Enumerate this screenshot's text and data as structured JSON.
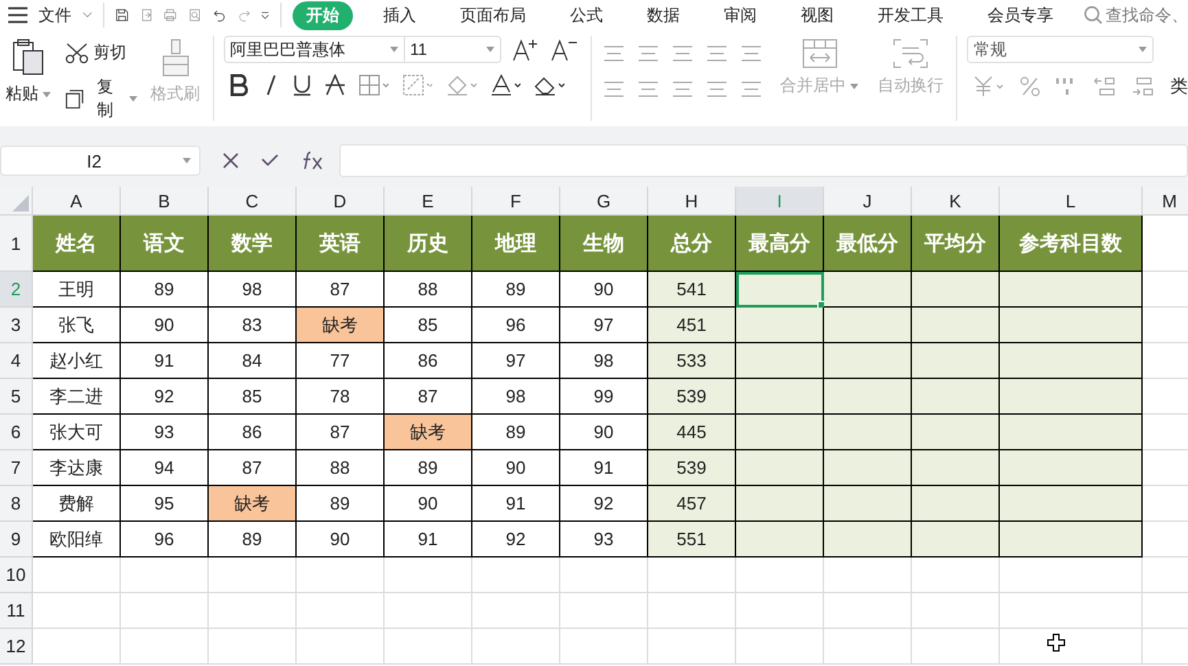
{
  "menu_bar": {
    "file_label": "文件",
    "tabs": [
      {
        "label": "开始",
        "selected": true
      },
      {
        "label": "插入",
        "selected": false
      },
      {
        "label": "页面布局",
        "selected": false
      },
      {
        "label": "公式",
        "selected": false
      },
      {
        "label": "数据",
        "selected": false
      },
      {
        "label": "审阅",
        "selected": false
      },
      {
        "label": "视图",
        "selected": false
      },
      {
        "label": "开发工具",
        "selected": false
      },
      {
        "label": "会员专享",
        "selected": false
      }
    ],
    "search": "查找命令、"
  },
  "ribbon": {
    "paste": "粘贴",
    "cut": "剪切",
    "copy": "复制",
    "format_painter": "格式刷",
    "font_family": "阿里巴巴普惠体",
    "font_size": "11",
    "merge_center": "合并居中",
    "wrap_text": "自动换行",
    "number_format": "常规",
    "type_label": "类"
  },
  "formula_bar": {
    "cell_ref": "I2"
  },
  "sheet": {
    "columns": [
      {
        "label": "A",
        "selected": false
      },
      {
        "label": "B",
        "selected": false
      },
      {
        "label": "C",
        "selected": false
      },
      {
        "label": "D",
        "selected": false
      },
      {
        "label": "E",
        "selected": false
      },
      {
        "label": "F",
        "selected": false
      },
      {
        "label": "G",
        "selected": false
      },
      {
        "label": "H",
        "selected": false
      },
      {
        "label": "I",
        "selected": true
      },
      {
        "label": "J",
        "selected": false
      },
      {
        "label": "K",
        "selected": false
      },
      {
        "label": "L",
        "selected": false
      },
      {
        "label": "M",
        "selected": false
      }
    ],
    "rows": [
      {
        "label": "1",
        "selected": false,
        "cells": [
          {
            "text": "姓名",
            "kind": "header"
          },
          {
            "text": "语文",
            "kind": "header"
          },
          {
            "text": "数学",
            "kind": "header"
          },
          {
            "text": "英语",
            "kind": "header"
          },
          {
            "text": "历史",
            "kind": "header"
          },
          {
            "text": "地理",
            "kind": "header"
          },
          {
            "text": "生物",
            "kind": "header"
          },
          {
            "text": "总分",
            "kind": "header"
          },
          {
            "text": "最高分",
            "kind": "header"
          },
          {
            "text": "最低分",
            "kind": "header"
          },
          {
            "text": "平均分",
            "kind": "header"
          },
          {
            "text": "参考科目数",
            "kind": "header"
          }
        ]
      },
      {
        "label": "2",
        "selected": true,
        "cells": [
          {
            "text": "王明",
            "kind": "value"
          },
          {
            "text": "89",
            "kind": "value"
          },
          {
            "text": "98",
            "kind": "value"
          },
          {
            "text": "87",
            "kind": "value"
          },
          {
            "text": "88",
            "kind": "value"
          },
          {
            "text": "89",
            "kind": "value"
          },
          {
            "text": "90",
            "kind": "value"
          },
          {
            "text": "541",
            "kind": "total"
          },
          {
            "kind": "stat"
          },
          {
            "kind": "stat"
          },
          {
            "kind": "stat"
          },
          {
            "kind": "stat"
          }
        ]
      },
      {
        "label": "3",
        "selected": false,
        "cells": [
          {
            "text": "张飞",
            "kind": "value"
          },
          {
            "text": "90",
            "kind": "value"
          },
          {
            "text": "83",
            "kind": "value"
          },
          {
            "text": "缺考",
            "kind": "missing"
          },
          {
            "text": "85",
            "kind": "value"
          },
          {
            "text": "96",
            "kind": "value"
          },
          {
            "text": "97",
            "kind": "value"
          },
          {
            "text": "451",
            "kind": "total"
          },
          {
            "kind": "stat"
          },
          {
            "kind": "stat"
          },
          {
            "kind": "stat"
          },
          {
            "kind": "stat"
          }
        ]
      },
      {
        "label": "4",
        "selected": false,
        "cells": [
          {
            "text": "赵小红",
            "kind": "value"
          },
          {
            "text": "91",
            "kind": "value"
          },
          {
            "text": "84",
            "kind": "value"
          },
          {
            "text": "77",
            "kind": "value"
          },
          {
            "text": "86",
            "kind": "value"
          },
          {
            "text": "97",
            "kind": "value"
          },
          {
            "text": "98",
            "kind": "value"
          },
          {
            "text": "533",
            "kind": "total"
          },
          {
            "kind": "stat"
          },
          {
            "kind": "stat"
          },
          {
            "kind": "stat"
          },
          {
            "kind": "stat"
          }
        ]
      },
      {
        "label": "5",
        "selected": false,
        "cells": [
          {
            "text": "李二进",
            "kind": "value"
          },
          {
            "text": "92",
            "kind": "value"
          },
          {
            "text": "85",
            "kind": "value"
          },
          {
            "text": "78",
            "kind": "value"
          },
          {
            "text": "87",
            "kind": "value"
          },
          {
            "text": "98",
            "kind": "value"
          },
          {
            "text": "99",
            "kind": "value"
          },
          {
            "text": "539",
            "kind": "total"
          },
          {
            "kind": "stat"
          },
          {
            "kind": "stat"
          },
          {
            "kind": "stat"
          },
          {
            "kind": "stat"
          }
        ]
      },
      {
        "label": "6",
        "selected": false,
        "cells": [
          {
            "text": "张大可",
            "kind": "value"
          },
          {
            "text": "93",
            "kind": "value"
          },
          {
            "text": "86",
            "kind": "value"
          },
          {
            "text": "87",
            "kind": "value"
          },
          {
            "text": "缺考",
            "kind": "missing"
          },
          {
            "text": "89",
            "kind": "value"
          },
          {
            "text": "90",
            "kind": "value"
          },
          {
            "text": "445",
            "kind": "total"
          },
          {
            "kind": "stat"
          },
          {
            "kind": "stat"
          },
          {
            "kind": "stat"
          },
          {
            "kind": "stat"
          }
        ]
      },
      {
        "label": "7",
        "selected": false,
        "cells": [
          {
            "text": "李达康",
            "kind": "value"
          },
          {
            "text": "94",
            "kind": "value"
          },
          {
            "text": "87",
            "kind": "value"
          },
          {
            "text": "88",
            "kind": "value"
          },
          {
            "text": "89",
            "kind": "value"
          },
          {
            "text": "90",
            "kind": "value"
          },
          {
            "text": "91",
            "kind": "value"
          },
          {
            "text": "539",
            "kind": "total"
          },
          {
            "kind": "stat"
          },
          {
            "kind": "stat"
          },
          {
            "kind": "stat"
          },
          {
            "kind": "stat"
          }
        ]
      },
      {
        "label": "8",
        "selected": false,
        "cells": [
          {
            "text": "费解",
            "kind": "value"
          },
          {
            "text": "95",
            "kind": "value"
          },
          {
            "text": "缺考",
            "kind": "missing"
          },
          {
            "text": "89",
            "kind": "value"
          },
          {
            "text": "90",
            "kind": "value"
          },
          {
            "text": "91",
            "kind": "value"
          },
          {
            "text": "92",
            "kind": "value"
          },
          {
            "text": "457",
            "kind": "total"
          },
          {
            "kind": "stat"
          },
          {
            "kind": "stat"
          },
          {
            "kind": "stat"
          },
          {
            "kind": "stat"
          }
        ]
      },
      {
        "label": "9",
        "selected": false,
        "cells": [
          {
            "text": "欧阳绰",
            "kind": "value"
          },
          {
            "text": "96",
            "kind": "value"
          },
          {
            "text": "89",
            "kind": "value"
          },
          {
            "text": "90",
            "kind": "value"
          },
          {
            "text": "91",
            "kind": "value"
          },
          {
            "text": "92",
            "kind": "value"
          },
          {
            "text": "93",
            "kind": "value"
          },
          {
            "text": "551",
            "kind": "total"
          },
          {
            "kind": "stat"
          },
          {
            "kind": "stat"
          },
          {
            "kind": "stat"
          },
          {
            "kind": "stat"
          }
        ]
      },
      {
        "label": "10",
        "selected": false,
        "cells": []
      },
      {
        "label": "11",
        "selected": false,
        "cells": []
      },
      {
        "label": "12",
        "selected": false,
        "cells": []
      }
    ]
  }
}
